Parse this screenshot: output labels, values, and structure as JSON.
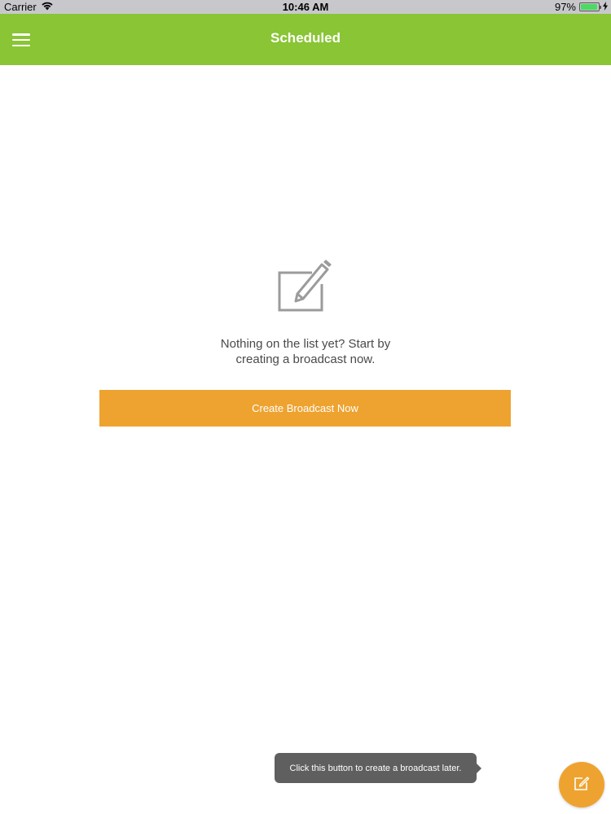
{
  "status_bar": {
    "carrier": "Carrier",
    "time": "10:46 AM",
    "battery_percent": "97%",
    "battery_level": 0.97,
    "wifi_icon": "wifi-icon",
    "charging_icon": "bolt-icon"
  },
  "nav": {
    "menu_icon": "hamburger-menu-icon",
    "title": "Scheduled"
  },
  "empty_state": {
    "icon": "compose-pencil-icon",
    "message_line1": "Nothing on the list yet? Start by",
    "message_line2": "creating a broadcast now.",
    "button_label": "Create Broadcast Now"
  },
  "tooltip": {
    "text": "Click this button to create a broadcast later."
  },
  "fab": {
    "icon": "compose-icon"
  },
  "colors": {
    "nav_green": "#89c534",
    "accent_orange": "#eea330",
    "tooltip_gray": "#5f5f5f",
    "text_gray": "#4a4a4a",
    "icon_gray": "#9b9b9b"
  }
}
